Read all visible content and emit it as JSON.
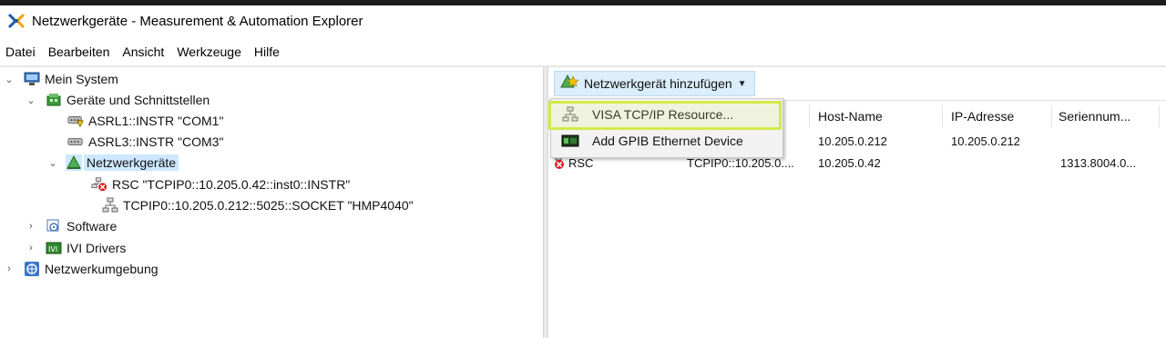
{
  "window": {
    "title": "Netzwerkgeräte - Measurement & Automation Explorer",
    "app_icon": "mae-app-icon"
  },
  "menu": {
    "items": [
      "Datei",
      "Bearbeiten",
      "Ansicht",
      "Werkzeuge",
      "Hilfe"
    ]
  },
  "tree": {
    "items": [
      {
        "label": "Mein System",
        "icon": "computer-icon",
        "expanded": true
      },
      {
        "label": "Geräte und Schnittstellen",
        "icon": "devices-icon",
        "expanded": true
      },
      {
        "label": "ASRL1::INSTR \"COM1\"",
        "icon": "serial-port-warning-icon"
      },
      {
        "label": "ASRL3::INSTR \"COM3\"",
        "icon": "serial-port-icon"
      },
      {
        "label": "Netzwerkgeräte",
        "icon": "network-devices-icon",
        "expanded": true,
        "selected": true
      },
      {
        "label": "RSC \"TCPIP0::10.205.0.42::inst0::INSTR\"",
        "icon": "network-device-error-icon"
      },
      {
        "label": "TCPIP0::10.205.0.212::5025::SOCKET \"HMP4040\"",
        "icon": "network-device-icon"
      },
      {
        "label": "Software",
        "icon": "software-icon",
        "expanded": false
      },
      {
        "label": "IVI Drivers",
        "icon": "ivi-drivers-icon",
        "expanded": false
      },
      {
        "label": "Netzwerkumgebung",
        "icon": "network-neighborhood-icon",
        "expanded": false
      }
    ]
  },
  "toolbar": {
    "add_button_label": "Netzwerkgerät hinzufügen"
  },
  "dropdown": {
    "items": [
      {
        "label": "VISA TCP/IP Resource...",
        "icon": "tcpip-resource-icon",
        "highlighted": true
      },
      {
        "label": "Add GPIB Ethernet Device",
        "icon": "gpib-ethernet-icon"
      }
    ]
  },
  "table": {
    "columns": [
      "Host-Name",
      "IP-Adresse",
      "Seriennum..."
    ],
    "rows": [
      {
        "name": "",
        "resource": "",
        "host": "10.205.0.212",
        "ip": "10.205.0.212",
        "serial": ""
      },
      {
        "name": "RSC",
        "resource": "TCPIP0::10.205.0....",
        "host": "10.205.0.42",
        "ip": "",
        "serial": "1313.8004.0..."
      }
    ]
  },
  "colors": {
    "selection": "#cde8ff",
    "toolbar_button": "#dbeefb",
    "highlight_annotation": "#d4e94a"
  }
}
